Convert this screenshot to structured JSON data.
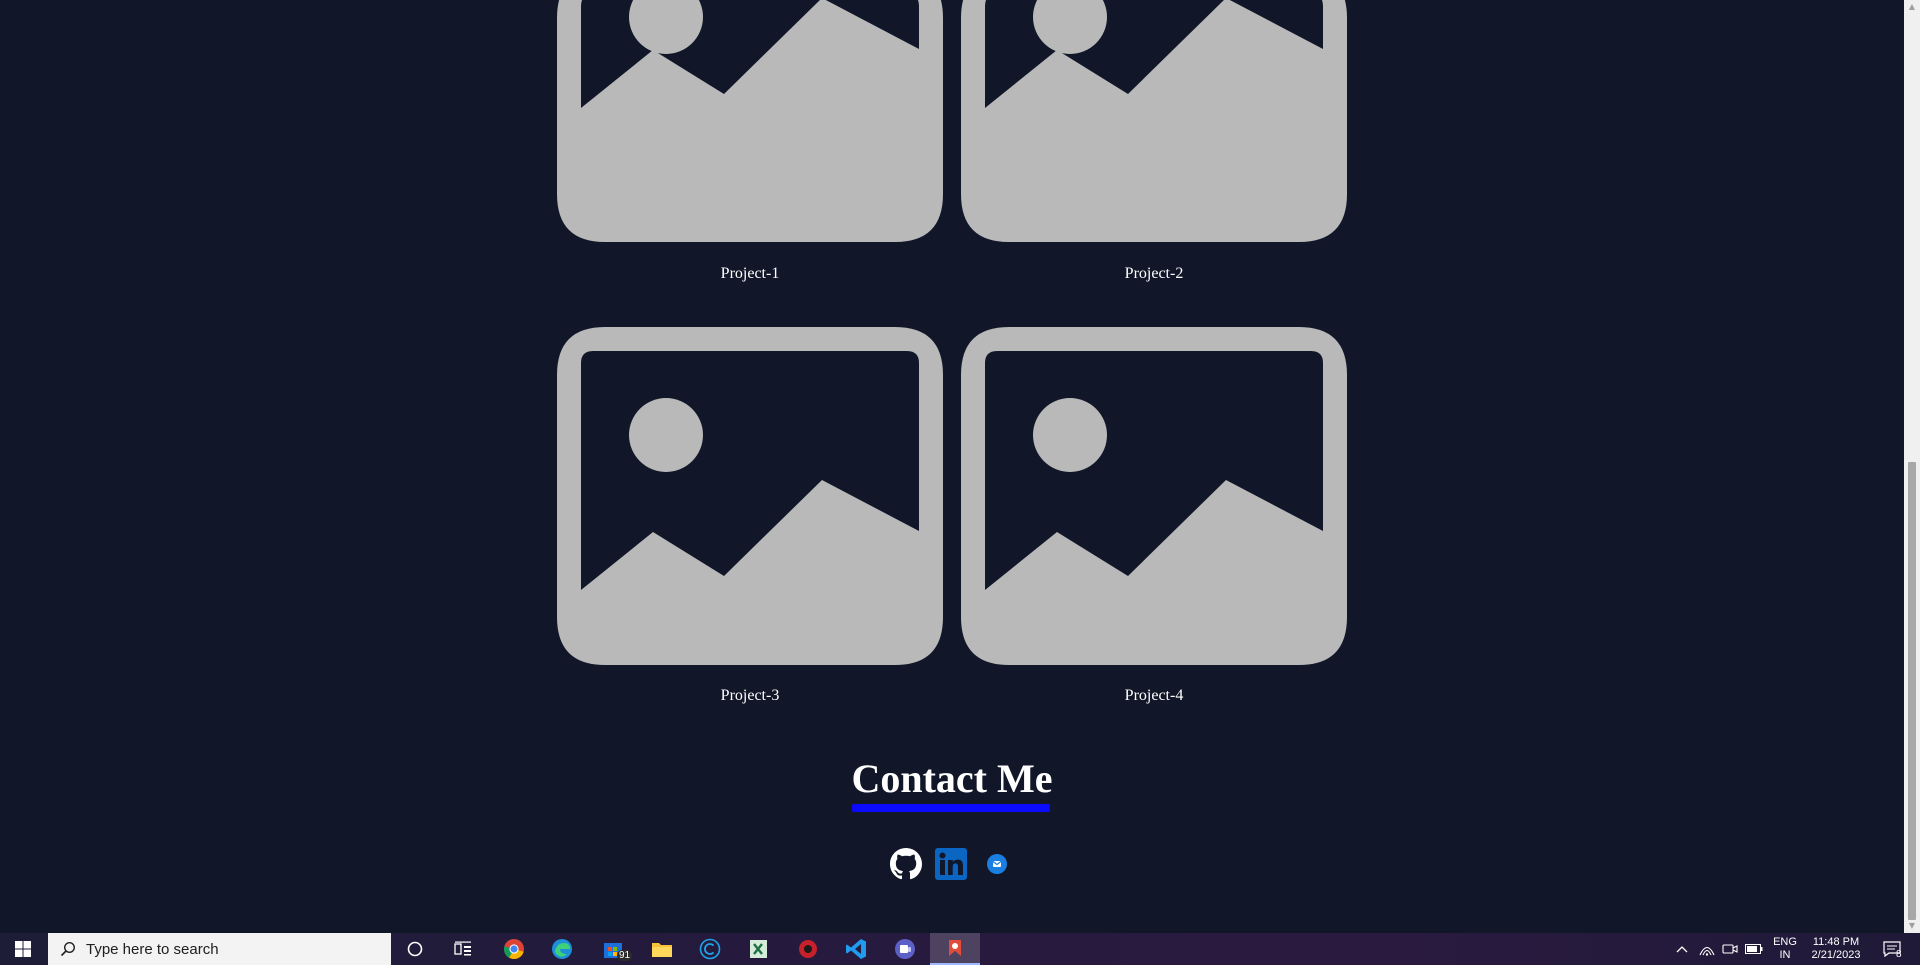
{
  "projects": [
    {
      "label": "Project-1"
    },
    {
      "label": "Project-2"
    },
    {
      "label": "Project-3"
    },
    {
      "label": "Project-4"
    }
  ],
  "contact": {
    "title": "Contact Me"
  },
  "social": [
    "github-icon",
    "linkedin-icon",
    "email-icon"
  ],
  "colors": {
    "background": "#111729",
    "placeholder": "#b9b9b9",
    "underline": "#0a0aff",
    "linkedin": "#0a66c2"
  },
  "taskbar": {
    "search_placeholder": "Type here to search",
    "store_badge": "91",
    "language_line1": "ENG",
    "language_line2": "IN",
    "time": "11:48 PM",
    "date": "2/21/2023",
    "notification_count": "8"
  }
}
